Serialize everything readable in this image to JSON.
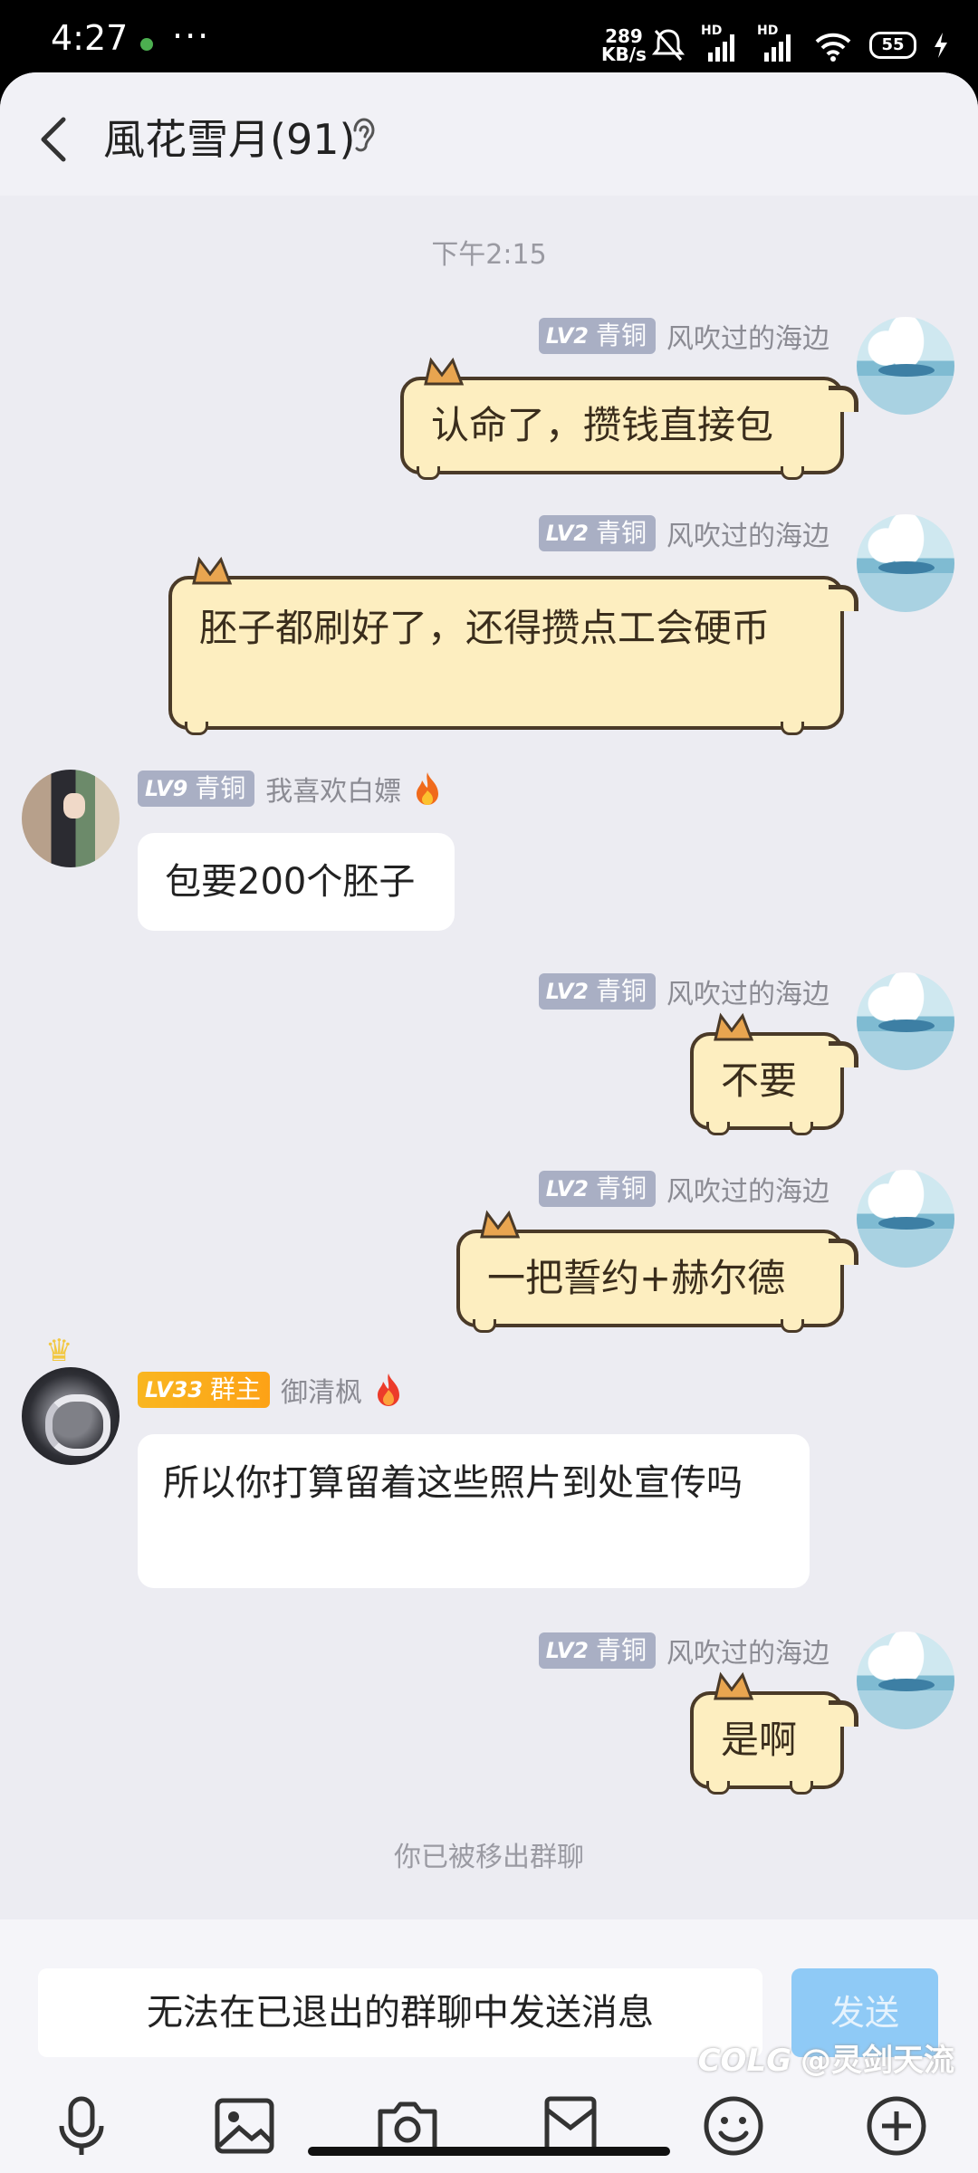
{
  "status_bar": {
    "time": "4:27",
    "more": "···",
    "net_speed_value": "289",
    "net_speed_unit": "KB/s",
    "signal1_label": "HD",
    "signal2_label": "HD",
    "battery": "55"
  },
  "header": {
    "title": "風花雪月(91)",
    "back_icon": "chevron-left-icon",
    "ear_icon": "ear-icon"
  },
  "chat": {
    "time_separator": "下午2:15",
    "messages": [
      {
        "side": "right",
        "level": "LV2",
        "title": "青铜",
        "nickname": "风吹过的海边",
        "text": "认命了，攒钱直接包",
        "bubble": "cat"
      },
      {
        "side": "right",
        "level": "LV2",
        "title": "青铜",
        "nickname": "风吹过的海边",
        "text": "胚子都刷好了，还得攒点工会硬币",
        "bubble": "cat"
      },
      {
        "side": "left",
        "level": "LV9",
        "title": "青铜",
        "nickname": "我喜欢白嫖",
        "text": "包要200个胚子",
        "bubble": "white"
      },
      {
        "side": "right",
        "level": "LV2",
        "title": "青铜",
        "nickname": "风吹过的海边",
        "text": "不要",
        "bubble": "cat"
      },
      {
        "side": "right",
        "level": "LV2",
        "title": "青铜",
        "nickname": "风吹过的海边",
        "text": "一把誓约+赫尔德",
        "bubble": "cat"
      },
      {
        "side": "left",
        "level": "LV33",
        "title": "群主",
        "nickname": "御清枫",
        "text": "所以你打算留着这些照片到处宣传吗",
        "bubble": "white"
      },
      {
        "side": "right",
        "level": "LV2",
        "title": "青铜",
        "nickname": "风吹过的海边",
        "text": "是啊",
        "bubble": "cat"
      }
    ],
    "system_notice": "你已被移出群聊"
  },
  "input_bar": {
    "disabled_text": "无法在已退出的群聊中发送消息",
    "send_label": "发送",
    "send_color": "#8fcaf6",
    "tools": [
      "microphone-icon",
      "image-icon",
      "camera-icon",
      "red-packet-icon",
      "emoji-icon",
      "plus-icon"
    ]
  },
  "watermark": "@灵剑天流",
  "watermark_logo": "COLG"
}
